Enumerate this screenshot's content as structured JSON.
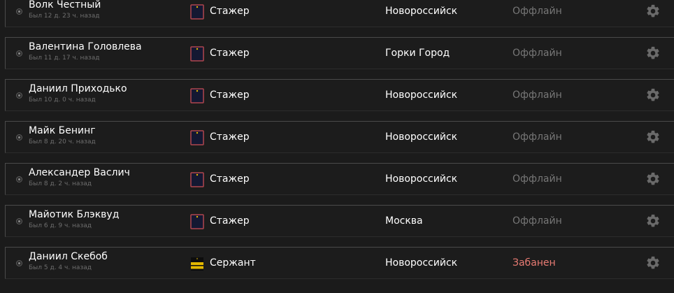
{
  "colors": {
    "offline": "#777777",
    "banned": "#e87b73",
    "trainee_badge_fill": "#141832",
    "trainee_badge_border": "#b0464e",
    "sergeant_badge": "#e3b800"
  },
  "players": [
    {
      "name": "Волк Честный",
      "last_seen": "Был 12 д. 23 ч. назад",
      "rank": "Стажер",
      "rank_icon": "trainee-badge-icon",
      "city": "Новороссийск",
      "status": "Оффлайн",
      "status_kind": "offline"
    },
    {
      "name": "Валентина Головлева",
      "last_seen": "Был 11 д. 17 ч. назад",
      "rank": "Стажер",
      "rank_icon": "trainee-badge-icon",
      "city": "Горки Город",
      "status": "Оффлайн",
      "status_kind": "offline"
    },
    {
      "name": "Даниил Приходько",
      "last_seen": "Был 10 д. 0 ч. назад",
      "rank": "Стажер",
      "rank_icon": "trainee-badge-icon",
      "city": "Новороссийск",
      "status": "Оффлайн",
      "status_kind": "offline"
    },
    {
      "name": "Майк Бенинг",
      "last_seen": "Был 8 д. 20 ч. назад",
      "rank": "Стажер",
      "rank_icon": "trainee-badge-icon",
      "city": "Новороссийск",
      "status": "Оффлайн",
      "status_kind": "offline"
    },
    {
      "name": "Александер Васлич",
      "last_seen": "Был 8 д. 2 ч. назад",
      "rank": "Стажер",
      "rank_icon": "trainee-badge-icon",
      "city": "Новороссийск",
      "status": "Оффлайн",
      "status_kind": "offline"
    },
    {
      "name": "Майотик Блэквуд",
      "last_seen": "Был 6 д. 9 ч. назад",
      "rank": "Стажер",
      "rank_icon": "trainee-badge-icon",
      "city": "Москва",
      "status": "Оффлайн",
      "status_kind": "offline"
    },
    {
      "name": "Даниил Скебоб",
      "last_seen": "Был 5 д. 4 ч. назад",
      "rank": "Сержант",
      "rank_icon": "sergeant-badge-icon",
      "city": "Новороссийск",
      "status": "Забанен",
      "status_kind": "banned"
    }
  ]
}
